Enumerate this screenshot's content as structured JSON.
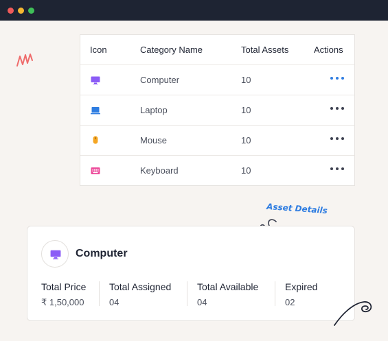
{
  "window": {
    "controls": [
      "close",
      "minimize",
      "maximize"
    ]
  },
  "table": {
    "headers": {
      "icon": "Icon",
      "name": "Category Name",
      "total": "Total Assets",
      "actions": "Actions"
    },
    "rows": [
      {
        "icon": "monitor-icon",
        "color": "#8b5cf6",
        "name": "Computer",
        "total": "10",
        "actions_active": true
      },
      {
        "icon": "laptop-icon",
        "color": "#2f7de1",
        "name": "Laptop",
        "total": "10",
        "actions_active": false
      },
      {
        "icon": "mouse-icon",
        "color": "#f5a623",
        "name": "Mouse",
        "total": "10",
        "actions_active": false
      },
      {
        "icon": "keyboard-icon",
        "color": "#ec4899",
        "name": "Keyboard",
        "total": "10",
        "actions_active": false
      }
    ]
  },
  "annotation": {
    "label": "Asset Details"
  },
  "detail": {
    "icon": "monitor-icon",
    "title": "Computer",
    "stats": [
      {
        "label": "Total Price",
        "value": "₹ 1,50,000"
      },
      {
        "label": "Total Assigned",
        "value": "04"
      },
      {
        "label": "Total Available",
        "value": "04"
      },
      {
        "label": "Expired",
        "value": "02"
      }
    ]
  },
  "colors": {
    "accent": "#2f7de1",
    "titlebar": "#1e2433",
    "background": "#f7f4f1"
  }
}
